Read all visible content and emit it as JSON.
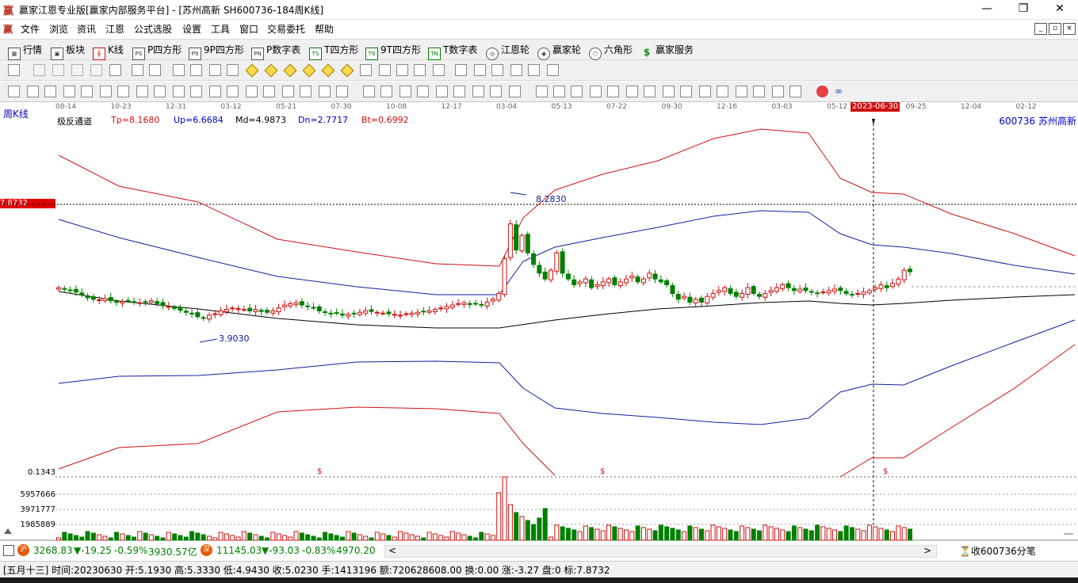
{
  "window": {
    "title": "赢家江恩专业版[赢家内部服务平台] - [苏州高新  SH600736-184周K线]",
    "app_logo_glyph": "赢",
    "minimize_label": "—",
    "maximize_label": "❐",
    "close_label": "✕"
  },
  "menu": {
    "items": [
      "文件",
      "浏览",
      "资讯",
      "江恩",
      "公式选股",
      "设置",
      "工具",
      "窗口",
      "交易委托",
      "帮助"
    ],
    "mdi_buttons": [
      "_",
      "▫",
      "×"
    ]
  },
  "toolbar1": {
    "items": [
      {
        "icon": "grid-icon",
        "glyph": "▦",
        "label": "行情"
      },
      {
        "icon": "block-icon",
        "glyph": "▣",
        "label": "板块"
      },
      {
        "icon": "kline-icon",
        "glyph": "╬",
        "label": "K线"
      },
      {
        "icon": "ps-icon",
        "glyph": "PS",
        "label": "P四方形"
      },
      {
        "icon": "p9-icon",
        "glyph": "P9",
        "label": "9P四方形"
      },
      {
        "icon": "pn-icon",
        "glyph": "PN",
        "label": "P数字表"
      },
      {
        "icon": "ts-icon",
        "glyph": "TS",
        "label": "T四方形"
      },
      {
        "icon": "t9-icon",
        "glyph": "T9",
        "label": "9T四方形"
      },
      {
        "icon": "tn-icon",
        "glyph": "TN",
        "label": "T数字表"
      },
      {
        "icon": "gann-wheel-icon",
        "glyph": "◎",
        "label": "江恩轮"
      },
      {
        "icon": "winner-wheel-icon",
        "glyph": "◉",
        "label": "赢家轮"
      },
      {
        "icon": "hexagon-icon",
        "glyph": "⬡",
        "label": "六角形"
      },
      {
        "icon": "dollar-icon",
        "glyph": "$",
        "label": "赢家服务"
      }
    ]
  },
  "chart": {
    "period_label": "周K线",
    "indicator_name": "极反通道",
    "indicator_values": [
      {
        "text": "Tp=8.1680",
        "color": "#d01010"
      },
      {
        "text": "Up=6.6684",
        "color": "#0000c0"
      },
      {
        "text": "Md=4.9873",
        "color": "#000000"
      },
      {
        "text": "Dn=2.7717",
        "color": "#0000c0"
      },
      {
        "text": "Bt=0.6992",
        "color": "#d01010"
      }
    ],
    "stock_code_name": "600736  苏州高新",
    "date_ticks": [
      "08-14",
      "10-23",
      "12-31",
      "03-12",
      "05-21",
      "07-30",
      "10-08",
      "12-17",
      "03-04",
      "05-13",
      "07-22",
      "09-30",
      "12-16",
      "03-03",
      "05-12",
      "09-25",
      "12-04",
      "02-12"
    ],
    "cursor_date": "2023-06-30",
    "price_tag": "7.8732",
    "max_label": "8.2830",
    "min_label": "3.9030",
    "dollar_marks": [
      "$",
      "$",
      "$"
    ],
    "colors": {
      "up": "#d01010",
      "down": "#008000",
      "upper_band": "#1020a0",
      "outer_band": "#d01010",
      "mid": "#000000"
    }
  },
  "volume": {
    "labels": [
      "0.1343",
      "5957666",
      "3971777",
      "1985889"
    ]
  },
  "status": {
    "sh_index": "3268.83",
    "sh_change": "▼-19.25",
    "sh_pct": "-0.59%",
    "sh_amount": "3930.57亿",
    "sz_index": "11145.03",
    "sz_change": "▼-93.03",
    "sz_pct": "-0.83%",
    "sz_amount": "4970.20",
    "sh_badge": "沪",
    "sz_badge": "深",
    "scroll_left": "<",
    "scroll_right": ">",
    "right_text": "收600736分笔"
  },
  "info": {
    "text": "[五月十三] 时间:20230630 开:5.1930 高:5.3330 低:4.9430 收:5.0230 手:1413196 额:720628608.00 换:0.00 涨:-3.27 盘:0 标:7.8732"
  },
  "chart_data": {
    "type": "candlestick",
    "title": "极反通道",
    "series": [
      {
        "name": "Tp",
        "last": 8.168
      },
      {
        "name": "Up",
        "last": 6.6684
      },
      {
        "name": "Md",
        "last": 4.9873
      },
      {
        "name": "Dn",
        "last": 2.7717
      },
      {
        "name": "Bt",
        "last": 0.6992
      }
    ],
    "closes": [
      5.0,
      4.95,
      4.9,
      4.85,
      4.75,
      4.65,
      4.6,
      4.58,
      4.62,
      4.55,
      4.5,
      4.52,
      4.55,
      4.5,
      4.48,
      4.52,
      4.55,
      4.45,
      4.38,
      4.35,
      4.28,
      4.22,
      4.15,
      4.1,
      4.0,
      3.95,
      4.05,
      4.1,
      4.2,
      4.25,
      4.3,
      4.28,
      4.25,
      4.2,
      4.25,
      4.18,
      4.15,
      4.2,
      4.3,
      4.4,
      4.45,
      4.48,
      4.4,
      4.35,
      4.3,
      4.2,
      4.15,
      4.1,
      4.12,
      4.05,
      4.08,
      4.1,
      4.15,
      4.2,
      4.18,
      4.15,
      4.12,
      4.1,
      4.08,
      4.05,
      4.1,
      4.12,
      4.15,
      4.18,
      4.2,
      4.25,
      4.3,
      4.35,
      4.4,
      4.45,
      4.48,
      4.42,
      4.45,
      4.4,
      4.5,
      4.6,
      4.8,
      6.0,
      7.2,
      6.3,
      6.8,
      6.2,
      5.8,
      5.5,
      5.3,
      5.6,
      6.2,
      5.5,
      5.3,
      5.1,
      5.2,
      5.3,
      5.0,
      5.1,
      5.2,
      5.3,
      5.1,
      5.2,
      5.3,
      5.4,
      5.2,
      5.3,
      5.5,
      5.3,
      5.2,
      5.1,
      4.8,
      4.6,
      4.7,
      4.5,
      4.6,
      4.5,
      4.7,
      4.8,
      4.9,
      5.0,
      4.8,
      4.7,
      4.8,
      5.0,
      4.8,
      4.7,
      4.8,
      4.9,
      5.0,
      5.1,
      5.0,
      4.9,
      4.95,
      4.9,
      4.85,
      4.8,
      4.85,
      4.9,
      4.95,
      4.9,
      4.8,
      4.75,
      4.8,
      4.85,
      4.9,
      5.0,
      5.1,
      5.0,
      5.15,
      5.3,
      5.6,
      5.55
    ],
    "cursor_date": "2023-06-30",
    "cursor_ohlc": {
      "open": 5.193,
      "high": 5.333,
      "low": 4.943,
      "close": 5.023
    },
    "marked_high": 8.283,
    "marked_low": 3.903,
    "reference_price": 7.8732
  }
}
